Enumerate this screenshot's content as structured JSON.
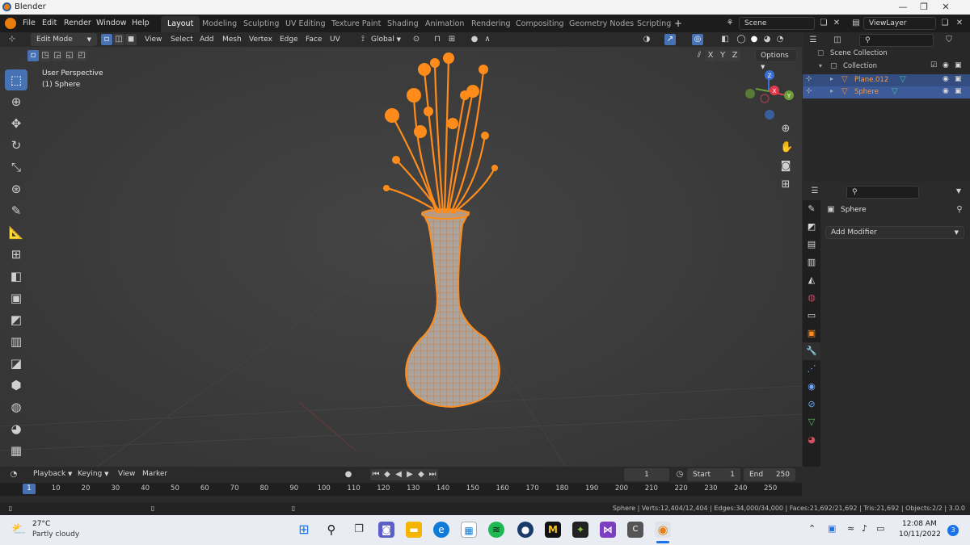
{
  "window": {
    "title": "Blender"
  },
  "menus": [
    "File",
    "Edit",
    "Render",
    "Window",
    "Help"
  ],
  "workspaces": [
    "Layout",
    "Modeling",
    "Sculpting",
    "UV Editing",
    "Texture Paint",
    "Shading",
    "Animation",
    "Rendering",
    "Compositing",
    "Geometry Nodes",
    "Scripting"
  ],
  "active_workspace": "Layout",
  "scene": {
    "name": "Scene",
    "view_layer": "ViewLayer"
  },
  "viewport_header": {
    "mode": "Edit Mode",
    "menus": [
      "View",
      "Select",
      "Add",
      "Mesh",
      "Vertex",
      "Edge",
      "Face",
      "UV"
    ],
    "orientation": "Global",
    "options_label": "Options",
    "axes": [
      "X",
      "Y",
      "Z"
    ]
  },
  "viewport": {
    "view_name": "User Perspective",
    "object_label": "(1) Sphere",
    "gizmo_axes": {
      "z": "Z",
      "x": "X",
      "y": "Y"
    }
  },
  "outliner": {
    "root": "Scene Collection",
    "collection": "Collection",
    "items": [
      {
        "name": "Plane.012"
      },
      {
        "name": "Sphere"
      }
    ]
  },
  "properties": {
    "object_name": "Sphere",
    "add_modifier": "Add Modifier"
  },
  "timeline": {
    "menus": [
      "Playback",
      "Keying",
      "View",
      "Marker"
    ],
    "current_frame": "1",
    "start_label": "Start",
    "start": "1",
    "end_label": "End",
    "end": "250",
    "ruler": [
      "1",
      "10",
      "20",
      "30",
      "40",
      "50",
      "60",
      "70",
      "80",
      "90",
      "100",
      "110",
      "120",
      "130",
      "140",
      "150",
      "160",
      "170",
      "180",
      "190",
      "200",
      "210",
      "220",
      "230",
      "240",
      "250"
    ]
  },
  "status": {
    "text": "Sphere | Verts:12,404/12,404 | Edges:34,000/34,000 | Faces:21,692/21,692 | Tris:21,692 | Objects:2/2 | 3.0.0"
  },
  "taskbar": {
    "weather_temp": "27°C",
    "weather_desc": "Partly cloudy",
    "time": "12:08 AM",
    "date": "10/11/2022",
    "notification_count": "3",
    "c_icon_label": "C",
    "m_icon_label": "M"
  },
  "colors": {
    "accent": "#4772b3",
    "selection": "#ff8c1a",
    "mesh": "#9a9a9a"
  }
}
